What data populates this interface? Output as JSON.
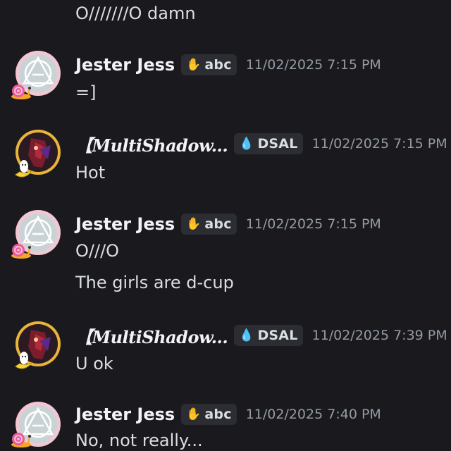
{
  "messages": [
    {
      "type": "continuation",
      "text": "O///////O damn"
    },
    {
      "type": "group",
      "author": "Jester Jess",
      "tag_label": "abc",
      "tag_icon": "hand-icon",
      "timestamp": "11/02/2025 7:15 PM",
      "lines": [
        "=]"
      ]
    },
    {
      "type": "group",
      "author": "【MultiShadow...",
      "tag_label": "DSAL",
      "tag_icon": "droplet-icon",
      "timestamp": "11/02/2025 7:15 PM",
      "lines": [
        "Hot"
      ]
    },
    {
      "type": "group",
      "author": "Jester Jess",
      "tag_label": "abc",
      "tag_icon": "hand-icon",
      "timestamp": "11/02/2025 7:15 PM",
      "lines": [
        "O///O",
        "The girls are d-cup"
      ]
    },
    {
      "type": "group",
      "author": "【MultiShadow...",
      "tag_label": "DSAL",
      "tag_icon": "droplet-icon",
      "timestamp": "11/02/2025 7:39 PM",
      "lines": [
        "U ok"
      ]
    },
    {
      "type": "group",
      "author": "Jester Jess",
      "tag_label": "abc",
      "tag_icon": "hand-icon",
      "timestamp": "11/02/2025 7:40 PM",
      "lines": [
        "No, not really..."
      ]
    }
  ],
  "icons": {
    "jester_avatar": "triangle-circle-avatar",
    "jester_decoration": "snail-icon",
    "shadow_avatar": "dark-character-avatar",
    "shadow_decoration": "banana-icon"
  },
  "colors": {
    "background": "#1a1a1e",
    "timestamp": "#949ba4",
    "tag_bg": "#2b2d33",
    "avatar_border_jess": "#f0b8c8",
    "avatar_border_shadow": "#e8b43a"
  }
}
